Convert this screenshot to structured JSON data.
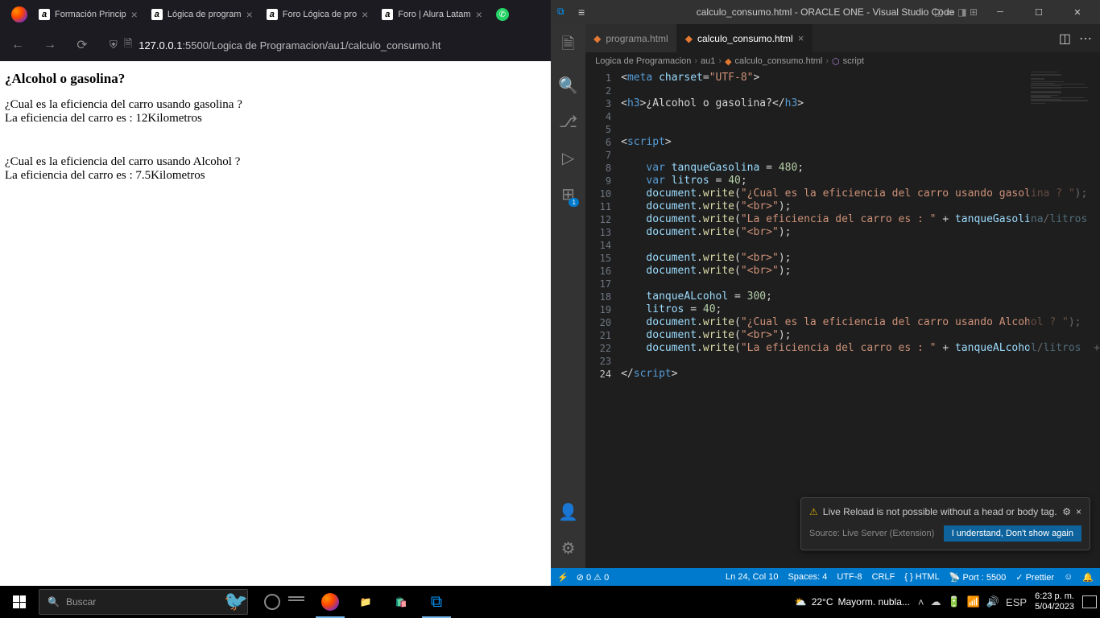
{
  "firefox": {
    "tabs": [
      {
        "title": "Formación Princip",
        "type": "a"
      },
      {
        "title": "Lógica de program",
        "type": "a"
      },
      {
        "title": "Foro Lógica de pro",
        "type": "a"
      },
      {
        "title": "Foro | Alura Latam",
        "type": "a"
      },
      {
        "title": "",
        "type": "wa"
      }
    ],
    "url_host": "127.0.0.1",
    "url_port": ":5500",
    "url_path": "/Logica de Programacion/au1/calculo_consumo.ht"
  },
  "page": {
    "heading": "¿Alcohol o gasolina?",
    "q1": "¿Cual es la eficiencia del carro usando gasolina ?",
    "a1": "La eficiencia del carro es : 12Kilometros",
    "q2": "¿Cual es la eficiencia del carro usando Alcohol ?",
    "a2": "La eficiencia del carro es : 7.5Kilometros"
  },
  "vscode": {
    "title": "calculo_consumo.html - ORACLE ONE - Visual Studio Code",
    "tabs": [
      {
        "name": "programa.html",
        "active": false
      },
      {
        "name": "calculo_consumo.html",
        "active": true
      }
    ],
    "breadcrumb": [
      "Logica de Programacion",
      "au1",
      "calculo_consumo.html",
      "script"
    ],
    "notification": {
      "msg": "Live Reload is not possible without a head or body tag.",
      "source": "Source: Live Server (Extension)",
      "button": "I understand, Don't show again"
    },
    "status": {
      "errors": "0",
      "warnings": "0",
      "ln_col": "Ln 24, Col 10",
      "spaces": "Spaces: 4",
      "encoding": "UTF-8",
      "eol": "CRLF",
      "lang": "HTML",
      "port": "Port : 5500",
      "prettier": "Prettier"
    },
    "code": {
      "l1_attr": "charset",
      "l1_val": "\"UTF-8\"",
      "l3_text": "¿Alcohol o gasolina?",
      "l8_var": "tanqueGasolina",
      "l8_val": "480",
      "l9_var": "litros",
      "l9_val": "40",
      "l10_str": "\"¿Cual es la eficiencia del carro usando gasolina ? \"",
      "l11_str": "\"<br>\"",
      "l13_str": "\"La eficiencia del carro es : \"",
      "l13_v1": "tanqueGasolina",
      "l13_v2": "litros",
      "l18_var": "tanqueALcohol",
      "l18_val": "300",
      "l19_var": "litros",
      "l19_val": "40",
      "l20_str": "\"¿Cual es la eficiencia del carro usando Alcohol ? \"",
      "l22_str": "\"La eficiencia del carro es : \"",
      "l22_v1": "tanqueALcohol",
      "l22_v2": "litros"
    }
  },
  "taskbar": {
    "search_placeholder": "Buscar",
    "weather_temp": "22°C",
    "weather_text": "Mayorm. nubla...",
    "lang": "ESP",
    "time": "6:23 p. m.",
    "date": "5/04/2023"
  }
}
